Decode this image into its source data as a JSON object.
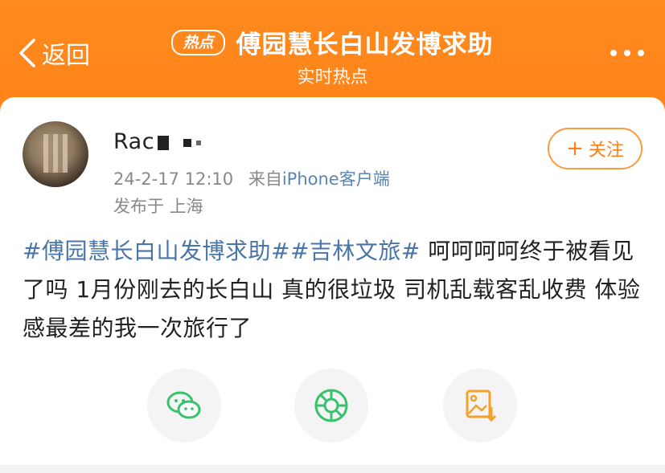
{
  "header": {
    "back_label": "返回",
    "badge": "热点",
    "title": "傅园慧长白山发博求助",
    "subtitle": "实时热点",
    "accent_color": "#ff7a12"
  },
  "post": {
    "username_visible": "Rac",
    "time": "24-2-17 12:10",
    "from_prefix": "来自",
    "source": "iPhone客户端",
    "location": "发布于 上海",
    "follow_label": "关注",
    "tags": [
      "#傅园慧长白山发博求助#",
      "#吉林文旅#"
    ],
    "text": " 呵呵呵呵终于被看见了吗 1月份刚去的长白山 真的很垃圾  司机乱载客乱收费 体验感最差的我一次旅行了"
  },
  "share": {
    "icons": [
      "wechat-icon",
      "moments-icon",
      "save-image-icon"
    ]
  }
}
